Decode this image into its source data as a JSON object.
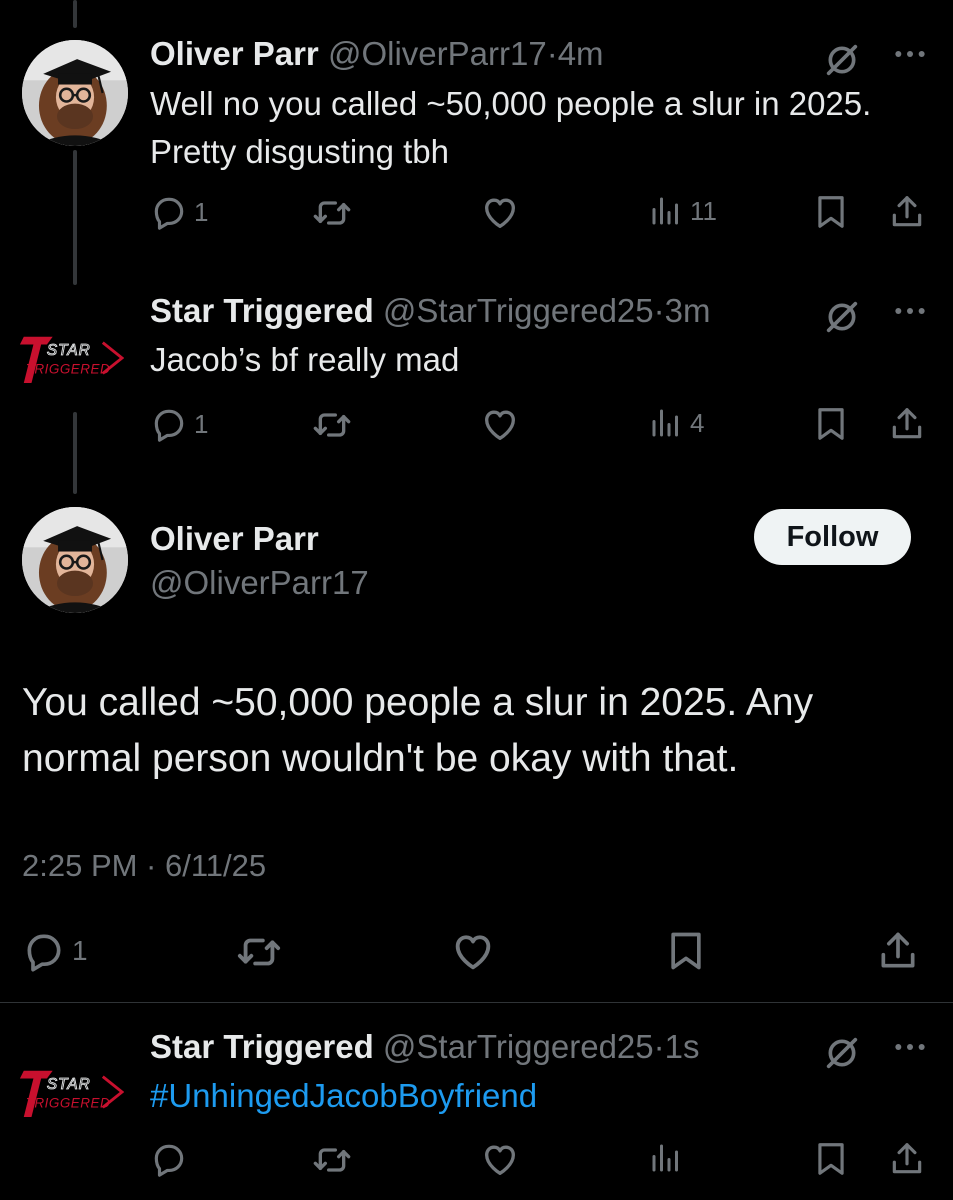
{
  "tweets": [
    {
      "name": "Oliver Parr",
      "handle": "@OliverParr17",
      "time": "4m",
      "text": "Well no you called ~50,000 people a slur in 2025. Pretty disgusting tbh",
      "replies": "1",
      "views": "11"
    },
    {
      "name": "Star Triggered",
      "handle": "@StarTriggered25",
      "time": "3m",
      "text": "Jacob’s bf really mad",
      "replies": "1",
      "views": "4",
      "logo_text": [
        "STAR",
        "TRIGGERED"
      ]
    }
  ],
  "focused": {
    "name": "Oliver Parr",
    "handle": "@OliverParr17",
    "follow_label": "Follow",
    "text": "You called ~50,000 people a slur in 2025. Any normal person wouldn't be okay with that.",
    "timestamp": "2:25 PM · 6/11/25",
    "replies": "1"
  },
  "reply": {
    "name": "Star Triggered",
    "handle": "@StarTriggered25",
    "time": "1s",
    "hashtag": "#UnhingedJacobBoyfriend"
  },
  "separator": "·",
  "colors": {
    "background": "#000000",
    "text": "#e7e9ea",
    "muted": "#71767b",
    "link": "#1d9bf0",
    "logo_red": "#c8102e"
  },
  "icons": [
    "reply-icon",
    "retweet-icon",
    "like-icon",
    "views-icon",
    "bookmark-icon",
    "share-icon",
    "muted-icon",
    "more-icon"
  ]
}
